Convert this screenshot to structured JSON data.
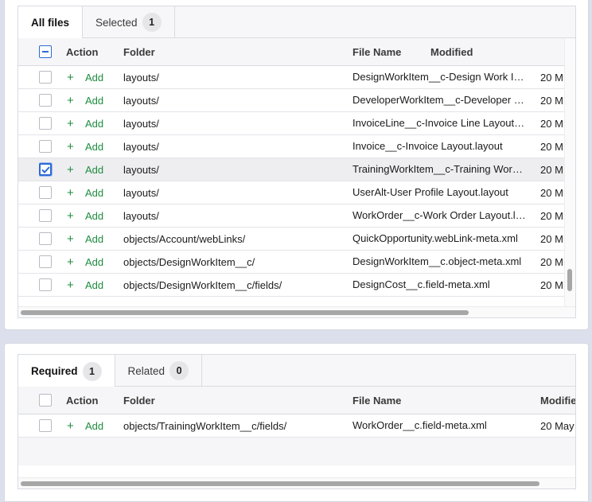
{
  "top": {
    "tabs": [
      {
        "label": "All files",
        "badge": null,
        "active": true
      },
      {
        "label": "Selected",
        "badge": "1",
        "active": false
      }
    ],
    "columns": {
      "action": "Action",
      "folder": "Folder",
      "file_name": "File Name",
      "modified": "Modified"
    },
    "header_checkbox": "indeterminate",
    "rows": [
      {
        "checked": false,
        "action": "Add",
        "folder": "layouts/",
        "file": "DesignWorkItem__c-Design Work Item Layout.layout",
        "date": "20 M"
      },
      {
        "checked": false,
        "action": "Add",
        "folder": "layouts/",
        "file": "DeveloperWorkItem__c-Developer Work Item Layout.layout",
        "date": "20 M"
      },
      {
        "checked": false,
        "action": "Add",
        "folder": "layouts/",
        "file": "InvoiceLine__c-Invoice Line Layout.layout",
        "date": "20 M"
      },
      {
        "checked": false,
        "action": "Add",
        "folder": "layouts/",
        "file": "Invoice__c-Invoice Layout.layout",
        "date": "20 M"
      },
      {
        "checked": true,
        "action": "Add",
        "folder": "layouts/",
        "file": "TrainingWorkItem__c-Training Work Item Layout.layout",
        "date": "20 M"
      },
      {
        "checked": false,
        "action": "Add",
        "folder": "layouts/",
        "file": "UserAlt-User Profile Layout.layout",
        "date": "20 M"
      },
      {
        "checked": false,
        "action": "Add",
        "folder": "layouts/",
        "file": "WorkOrder__c-Work Order Layout.layout",
        "date": "20 M"
      },
      {
        "checked": false,
        "action": "Add",
        "folder": "objects/Account/webLinks/",
        "file": "QuickOpportunity.webLink-meta.xml",
        "date": "20 M"
      },
      {
        "checked": false,
        "action": "Add",
        "folder": "objects/DesignWorkItem__c/",
        "file": "DesignWorkItem__c.object-meta.xml",
        "date": "20 M"
      },
      {
        "checked": false,
        "action": "Add",
        "folder": "objects/DesignWorkItem__c/fields/",
        "file": "DesignCost__c.field-meta.xml",
        "date": "20 M"
      }
    ]
  },
  "bottom": {
    "tabs": [
      {
        "label": "Required",
        "badge": "1",
        "active": true
      },
      {
        "label": "Related",
        "badge": "0",
        "active": false
      }
    ],
    "columns": {
      "action": "Action",
      "folder": "Folder",
      "file_name": "File Name",
      "modified": "Modifie"
    },
    "header_checkbox": "unchecked",
    "rows": [
      {
        "checked": false,
        "action": "Add",
        "folder": "objects/TrainingWorkItem__c/fields/",
        "file": "WorkOrder__c.field-meta.xml",
        "date": "20 May"
      }
    ]
  },
  "icons": {
    "add": "plus-icon",
    "check": "checkmark-icon",
    "minus": "minus-icon"
  },
  "colors": {
    "add_green": "#1e8c3f",
    "checkbox_blue": "#2d6ad6",
    "selected_row": "#eeeef0"
  }
}
